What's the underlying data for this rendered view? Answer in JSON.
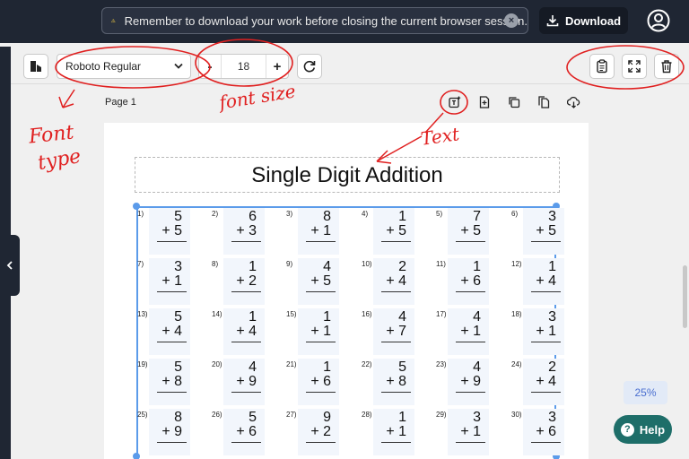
{
  "banner": {
    "message": "Remember to download your work before closing the current browser session.",
    "download_label": "Download"
  },
  "toolbar": {
    "font_value": "Roboto Regular",
    "size_minus": "-",
    "size_value": "18",
    "size_plus": "+"
  },
  "page": {
    "label": "Page 1",
    "title": "Single Digit Addition"
  },
  "problems": [
    {
      "n": "1)",
      "a": "5",
      "b": "+ 5"
    },
    {
      "n": "2)",
      "a": "6",
      "b": "+ 3"
    },
    {
      "n": "3)",
      "a": "8",
      "b": "+ 1"
    },
    {
      "n": "4)",
      "a": "1",
      "b": "+ 5"
    },
    {
      "n": "5)",
      "a": "7",
      "b": "+ 5"
    },
    {
      "n": "6)",
      "a": "3",
      "b": "+ 5"
    },
    {
      "n": "7)",
      "a": "3",
      "b": "+ 1"
    },
    {
      "n": "8)",
      "a": "1",
      "b": "+ 2"
    },
    {
      "n": "9)",
      "a": "4",
      "b": "+ 5"
    },
    {
      "n": "10)",
      "a": "2",
      "b": "+ 4"
    },
    {
      "n": "11)",
      "a": "1",
      "b": "+ 6"
    },
    {
      "n": "12)",
      "a": "1",
      "b": "+ 4"
    },
    {
      "n": "13)",
      "a": "5",
      "b": "+ 4"
    },
    {
      "n": "14)",
      "a": "1",
      "b": "+ 4"
    },
    {
      "n": "15)",
      "a": "1",
      "b": "+ 1"
    },
    {
      "n": "16)",
      "a": "4",
      "b": "+ 7"
    },
    {
      "n": "17)",
      "a": "4",
      "b": "+ 1"
    },
    {
      "n": "18)",
      "a": "3",
      "b": "+ 1"
    },
    {
      "n": "19)",
      "a": "5",
      "b": "+ 8"
    },
    {
      "n": "20)",
      "a": "4",
      "b": "+ 9"
    },
    {
      "n": "21)",
      "a": "1",
      "b": "+ 6"
    },
    {
      "n": "22)",
      "a": "5",
      "b": "+ 8"
    },
    {
      "n": "23)",
      "a": "4",
      "b": "+ 9"
    },
    {
      "n": "24)",
      "a": "2",
      "b": "+ 4"
    },
    {
      "n": "25)",
      "a": "8",
      "b": "+ 9"
    },
    {
      "n": "26)",
      "a": "5",
      "b": "+ 6"
    },
    {
      "n": "27)",
      "a": "9",
      "b": "+ 2"
    },
    {
      "n": "28)",
      "a": "1",
      "b": "+ 1"
    },
    {
      "n": "29)",
      "a": "3",
      "b": "+ 1"
    },
    {
      "n": "30)",
      "a": "3",
      "b": "+ 6"
    }
  ],
  "zoom": {
    "value": "25%"
  },
  "help": {
    "label": "Help",
    "glyph": "?"
  },
  "annotations": {
    "font_type": [
      "Font",
      "type"
    ],
    "font_size": "font size",
    "text": "Text"
  },
  "colors": {
    "topbar": "#1f2633",
    "accent_blue": "#5b9bea",
    "help_green": "#1e6e69",
    "annotation_red": "#e02020"
  }
}
